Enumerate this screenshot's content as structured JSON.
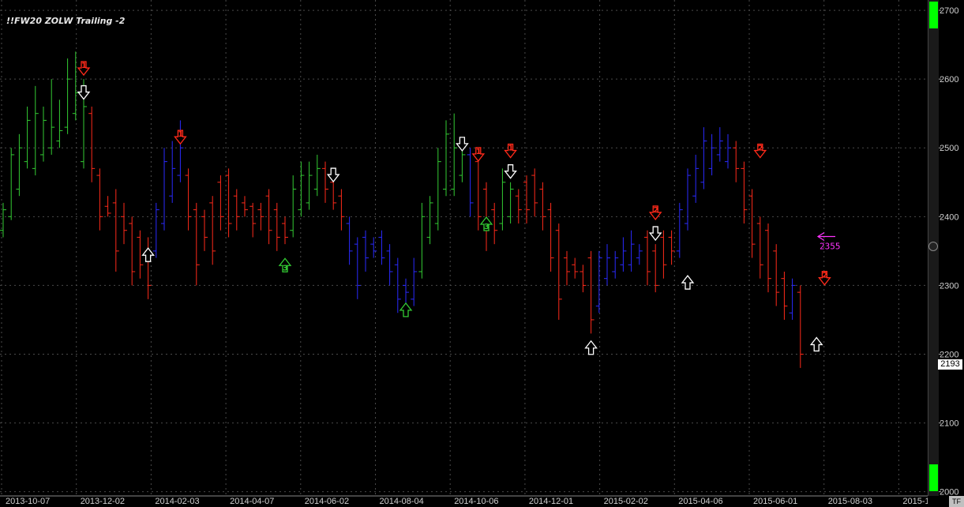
{
  "title": "!!FW20 ZOLW Trailing -2",
  "colors": {
    "background": "#000000",
    "up": "#33cc33",
    "down": "#ff2a1a",
    "neutral": "#2a2aff",
    "grid": "#4a4a4a",
    "marker": "#ff33ff"
  },
  "last_price_label": "2193",
  "tf_button": "TF",
  "chart_data": {
    "type": "bar",
    "title": "!!FW20 ZOLW Trailing -2",
    "ylim": [
      1995,
      2715
    ],
    "y_ticks": [
      2000,
      2100,
      2200,
      2300,
      2400,
      2500,
      2600,
      2700
    ],
    "x_ticks": [
      "2013-10-07",
      "2013-12-02",
      "2014-02-03",
      "2014-04-07",
      "2014-06-02",
      "2014-08-04",
      "2014-10-06",
      "2014-12-01",
      "2015-02-02",
      "2015-04-06",
      "2015-06-01",
      "2015-08-03",
      "2015-1"
    ],
    "grid": true,
    "bar_style": "ohlc",
    "bars": [
      [
        "g",
        2370,
        2420,
        2380,
        2410
      ],
      [
        "g",
        2395,
        2500,
        2400,
        2490
      ],
      [
        "g",
        2430,
        2520,
        2440,
        2500
      ],
      [
        "g",
        2470,
        2560,
        2480,
        2540
      ],
      [
        "g",
        2460,
        2590,
        2470,
        2550
      ],
      [
        "g",
        2480,
        2560,
        2490,
        2540
      ],
      [
        "g",
        2490,
        2600,
        2500,
        2530
      ],
      [
        "g",
        2500,
        2570,
        2510,
        2525
      ],
      [
        "g",
        2520,
        2630,
        2530,
        2600
      ],
      [
        "g",
        2540,
        2640,
        2550,
        2580
      ],
      [
        "g",
        2470,
        2600,
        2480,
        2560
      ],
      [
        "r",
        2450,
        2560,
        2550,
        2470
      ],
      [
        "r",
        2380,
        2470,
        2460,
        2400
      ],
      [
        "r",
        2400,
        2430,
        2415,
        2405
      ],
      [
        "r",
        2320,
        2440,
        2420,
        2350
      ],
      [
        "r",
        2360,
        2420,
        2400,
        2380
      ],
      [
        "r",
        2300,
        2400,
        2390,
        2320
      ],
      [
        "r",
        2310,
        2380,
        2370,
        2330
      ],
      [
        "r",
        2280,
        2370,
        2350,
        2300
      ],
      [
        "b",
        2340,
        2420,
        2350,
        2410
      ],
      [
        "b",
        2380,
        2500,
        2390,
        2480
      ],
      [
        "b",
        2420,
        2510,
        2430,
        2470
      ],
      [
        "b",
        2450,
        2540,
        2460,
        2500
      ],
      [
        "r",
        2380,
        2470,
        2460,
        2400
      ],
      [
        "r",
        2300,
        2420,
        2410,
        2330
      ],
      [
        "r",
        2350,
        2410,
        2400,
        2370
      ],
      [
        "r",
        2330,
        2430,
        2420,
        2350
      ],
      [
        "r",
        2380,
        2460,
        2450,
        2400
      ],
      [
        "r",
        2370,
        2470,
        2460,
        2390
      ],
      [
        "r",
        2380,
        2440,
        2430,
        2400
      ],
      [
        "r",
        2400,
        2430,
        2420,
        2410
      ],
      [
        "r",
        2370,
        2420,
        2415,
        2390
      ],
      [
        "r",
        2380,
        2420,
        2410,
        2400
      ],
      [
        "r",
        2360,
        2440,
        2430,
        2380
      ],
      [
        "r",
        2350,
        2420,
        2410,
        2370
      ],
      [
        "r",
        2360,
        2400,
        2390,
        2370
      ],
      [
        "g",
        2370,
        2460,
        2380,
        2440
      ],
      [
        "g",
        2400,
        2480,
        2410,
        2460
      ],
      [
        "g",
        2410,
        2480,
        2420,
        2460
      ],
      [
        "g",
        2430,
        2490,
        2440,
        2470
      ],
      [
        "r",
        2420,
        2480,
        2470,
        2440
      ],
      [
        "r",
        2410,
        2460,
        2450,
        2420
      ],
      [
        "r",
        2380,
        2440,
        2430,
        2400
      ],
      [
        "b",
        2330,
        2400,
        2390,
        2350
      ],
      [
        "b",
        2280,
        2370,
        2360,
        2300
      ],
      [
        "b",
        2320,
        2380,
        2370,
        2340
      ],
      [
        "b",
        2340,
        2370,
        2360,
        2350
      ],
      [
        "b",
        2330,
        2380,
        2370,
        2340
      ],
      [
        "b",
        2300,
        2360,
        2350,
        2320
      ],
      [
        "b",
        2260,
        2340,
        2330,
        2280
      ],
      [
        "b",
        2270,
        2310,
        2300,
        2290
      ],
      [
        "b",
        2270,
        2340,
        2280,
        2320
      ],
      [
        "g",
        2310,
        2420,
        2320,
        2400
      ],
      [
        "g",
        2360,
        2430,
        2370,
        2420
      ],
      [
        "g",
        2380,
        2500,
        2390,
        2480
      ],
      [
        "g",
        2430,
        2540,
        2440,
        2520
      ],
      [
        "g",
        2430,
        2550,
        2440,
        2500
      ],
      [
        "g",
        2450,
        2500,
        2460,
        2490
      ],
      [
        "b",
        2400,
        2500,
        2490,
        2420
      ],
      [
        "r",
        2380,
        2490,
        2480,
        2400
      ],
      [
        "r",
        2350,
        2450,
        2440,
        2380
      ],
      [
        "r",
        2360,
        2420,
        2410,
        2380
      ],
      [
        "g",
        2380,
        2470,
        2390,
        2450
      ],
      [
        "g",
        2390,
        2450,
        2400,
        2440
      ],
      [
        "r",
        2390,
        2440,
        2430,
        2410
      ],
      [
        "r",
        2390,
        2460,
        2450,
        2410
      ],
      [
        "r",
        2400,
        2470,
        2460,
        2420
      ],
      [
        "r",
        2380,
        2450,
        2440,
        2400
      ],
      [
        "r",
        2320,
        2420,
        2410,
        2340
      ],
      [
        "r",
        2250,
        2390,
        2380,
        2280
      ],
      [
        "r",
        2300,
        2350,
        2340,
        2320
      ],
      [
        "r",
        2310,
        2340,
        2330,
        2320
      ],
      [
        "r",
        2290,
        2330,
        2320,
        2300
      ],
      [
        "r",
        2230,
        2350,
        2340,
        2250
      ],
      [
        "b",
        2260,
        2350,
        2270,
        2340
      ],
      [
        "b",
        2300,
        2360,
        2310,
        2340
      ],
      [
        "b",
        2310,
        2350,
        2320,
        2340
      ],
      [
        "b",
        2320,
        2370,
        2330,
        2350
      ],
      [
        "b",
        2320,
        2380,
        2330,
        2360
      ],
      [
        "b",
        2330,
        2360,
        2340,
        2350
      ],
      [
        "r",
        2300,
        2380,
        2370,
        2320
      ],
      [
        "r",
        2290,
        2360,
        2350,
        2300
      ],
      [
        "r",
        2310,
        2380,
        2370,
        2330
      ],
      [
        "r",
        2330,
        2380,
        2370,
        2350
      ],
      [
        "b",
        2340,
        2420,
        2350,
        2410
      ],
      [
        "b",
        2380,
        2470,
        2390,
        2460
      ],
      [
        "b",
        2420,
        2490,
        2430,
        2470
      ],
      [
        "b",
        2440,
        2530,
        2450,
        2510
      ],
      [
        "b",
        2460,
        2520,
        2470,
        2500
      ],
      [
        "b",
        2480,
        2530,
        2490,
        2510
      ],
      [
        "b",
        2470,
        2520,
        2480,
        2500
      ],
      [
        "r",
        2450,
        2510,
        2500,
        2470
      ],
      [
        "r",
        2390,
        2480,
        2470,
        2410
      ],
      [
        "r",
        2340,
        2440,
        2430,
        2360
      ],
      [
        "r",
        2310,
        2400,
        2390,
        2330
      ],
      [
        "r",
        2290,
        2390,
        2380,
        2310
      ],
      [
        "r",
        2270,
        2360,
        2350,
        2290
      ],
      [
        "r",
        2250,
        2320,
        2310,
        2270
      ],
      [
        "b",
        2250,
        2310,
        2260,
        2300
      ],
      [
        "r",
        2180,
        2300,
        2290,
        2200
      ]
    ],
    "signals": [
      {
        "bar": 10,
        "dir": "down",
        "label": "1",
        "color": "#ff2a1a",
        "price": 2615
      },
      {
        "bar": 10,
        "dir": "down",
        "label": "",
        "color": "#ffffff",
        "price": 2580
      },
      {
        "bar": 18,
        "dir": "up",
        "label": "",
        "color": "#ffffff",
        "price": 2345
      },
      {
        "bar": 22,
        "dir": "down",
        "label": "1",
        "color": "#ff2a1a",
        "price": 2515
      },
      {
        "bar": 35,
        "dir": "up",
        "label": "3",
        "color": "#33cc33",
        "price": 2330
      },
      {
        "bar": 41,
        "dir": "down",
        "label": "",
        "color": "#ffffff",
        "price": 2460
      },
      {
        "bar": 50,
        "dir": "up",
        "label": "",
        "color": "#33cc33",
        "price": 2265
      },
      {
        "bar": 57,
        "dir": "down",
        "label": "",
        "color": "#ffffff",
        "price": 2505
      },
      {
        "bar": 59,
        "dir": "down",
        "label": "1",
        "color": "#ff2a1a",
        "price": 2490
      },
      {
        "bar": 60,
        "dir": "up",
        "label": "3",
        "color": "#33cc33",
        "price": 2390
      },
      {
        "bar": 63,
        "dir": "down",
        "label": "1",
        "color": "#ff2a1a",
        "price": 2495
      },
      {
        "bar": 63,
        "dir": "down",
        "label": "",
        "color": "#ffffff",
        "price": 2465
      },
      {
        "bar": 73,
        "dir": "up",
        "label": "",
        "color": "#ffffff",
        "price": 2210
      },
      {
        "bar": 81,
        "dir": "down",
        "label": "2",
        "color": "#ff2a1a",
        "price": 2405
      },
      {
        "bar": 81,
        "dir": "down",
        "label": "",
        "color": "#ffffff",
        "price": 2375
      },
      {
        "bar": 85,
        "dir": "up",
        "label": "",
        "color": "#ffffff",
        "price": 2305
      },
      {
        "bar": 94,
        "dir": "down",
        "label": "2",
        "color": "#ff2a1a",
        "price": 2495
      },
      {
        "bar": 101,
        "dir": "up",
        "label": "",
        "color": "#ffffff",
        "price": 2215
      },
      {
        "bar": 102,
        "dir": "down",
        "label": "2",
        "color": "#ff2a1a",
        "price": 2310
      }
    ],
    "stop_marker": {
      "value": 2355,
      "label": "2355"
    }
  }
}
